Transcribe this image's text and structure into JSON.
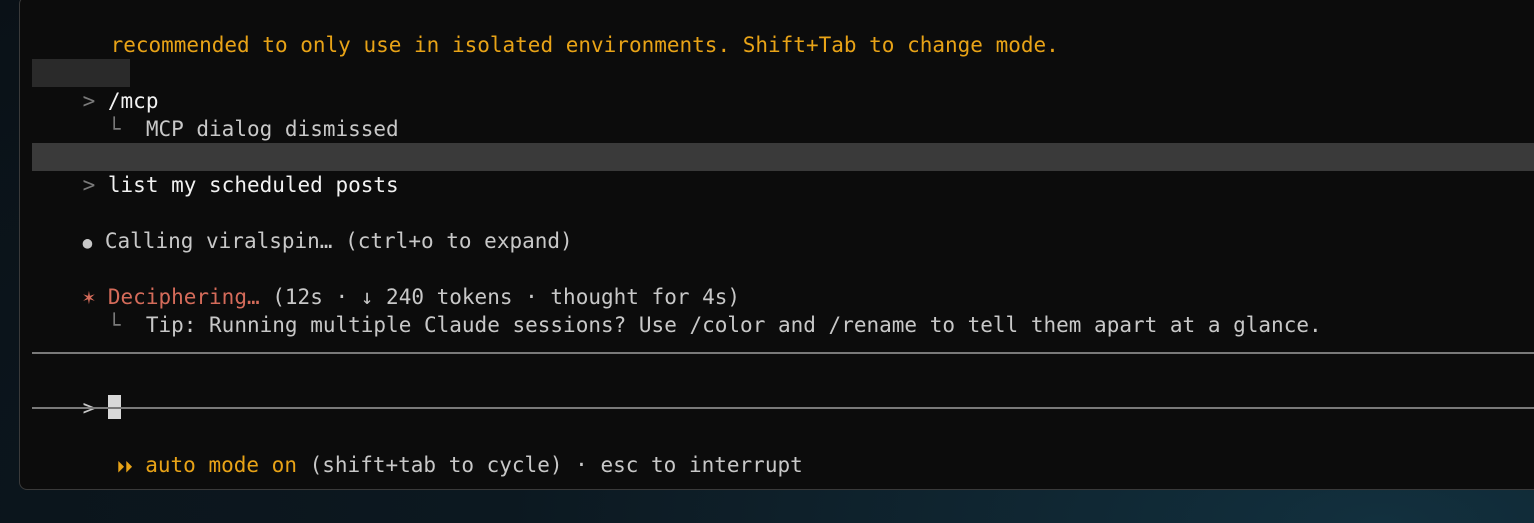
{
  "notice": {
    "text": "recommended to only use in isolated environments. Shift+Tab to change mode."
  },
  "history": {
    "command": {
      "prompt_symbol": ">",
      "text": "/mcp",
      "result_prefix": "└",
      "result": "MCP dialog dismissed"
    },
    "user_message": {
      "prompt_symbol": ">",
      "text": "list my scheduled posts"
    },
    "tool_call": {
      "bullet": "●",
      "text": "Calling viralspin…",
      "hint": "(ctrl+o to expand)"
    },
    "status": {
      "spinner": "✶",
      "verb": "Deciphering…",
      "details": "(12s · ↓ 240 tokens · thought for 4s)",
      "tip_prefix": "└",
      "tip": "Tip: Running multiple Claude sessions? Use /color and /rename to tell them apart at a glance."
    }
  },
  "input": {
    "prompt_symbol": ">",
    "value": ""
  },
  "footer": {
    "mode_icon": "⏵⏵",
    "mode_label": "auto mode on",
    "mode_hint": "(shift+tab to cycle)",
    "separator": "·",
    "interrupt_hint": "esc to interrupt"
  },
  "colors": {
    "accent": "#e8a317",
    "spinner": "#d46b5a",
    "background": "#0c0c0c"
  }
}
